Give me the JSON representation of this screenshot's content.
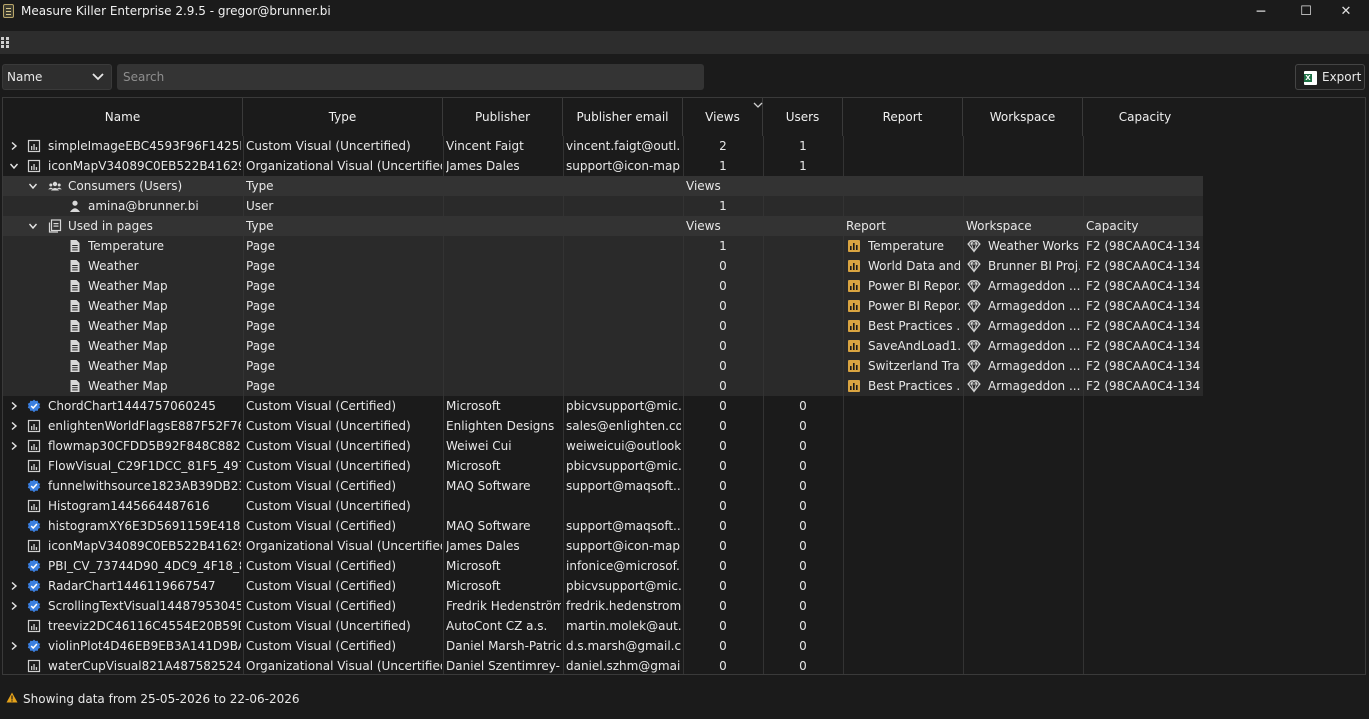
{
  "window": {
    "title": "Measure Killer Enterprise 2.9.5 - gregor@brunner.bi",
    "minimize": "─",
    "maximize": "☐",
    "close": "✕"
  },
  "toolbar": {
    "filter_selected": "Name",
    "search_placeholder": "Search",
    "export_label": "Export"
  },
  "columns": [
    "Name",
    "Type",
    "Publisher",
    "Publisher email",
    "Views",
    "Users",
    "Report",
    "Workspace",
    "Capacity"
  ],
  "visuals": [
    {
      "name": "simpleImageEBC4593F96F1425FB3...",
      "type": "Custom Visual (Uncertified)",
      "publisher": "Vincent Faigt",
      "email": "vincent.faigt@outl...",
      "views": "2",
      "users": "1",
      "expander": "collapsed",
      "icon": "chart-icon"
    },
    {
      "name": "iconMapV34089C0EB522B416294A...",
      "type": "Organizational Visual (Uncertified)",
      "publisher": "James Dales",
      "email": "support@icon-map...",
      "views": "1",
      "users": "1",
      "expander": "expanded",
      "icon": "chart-icon"
    },
    {
      "name": "ChordChart1444757060245",
      "type": "Custom Visual (Certified)",
      "publisher": "Microsoft",
      "email": "pbicvsupport@mic...",
      "views": "0",
      "users": "0",
      "expander": "collapsed",
      "icon": "certified-badge-icon"
    },
    {
      "name": "enlightenWorldFlagsE887F52F7624...",
      "type": "Custom Visual (Uncertified)",
      "publisher": "Enlighten Designs",
      "email": "sales@enlighten.co...",
      "views": "0",
      "users": "0",
      "expander": "collapsed",
      "icon": "chart-icon"
    },
    {
      "name": "flowmap30CFDD5B92F848C88242...",
      "type": "Custom Visual (Uncertified)",
      "publisher": "Weiwei Cui",
      "email": "weiweicui@outlook...",
      "views": "0",
      "users": "0",
      "expander": "collapsed",
      "icon": "chart-icon"
    },
    {
      "name": "FlowVisual_C29F1DCC_81F5_4973_...",
      "type": "Custom Visual (Uncertified)",
      "publisher": "Microsoft",
      "email": "pbicvsupport@mic...",
      "views": "0",
      "users": "0",
      "expander": "none",
      "icon": "chart-icon"
    },
    {
      "name": "funnelwithsource1823AB39DB234...",
      "type": "Custom Visual (Certified)",
      "publisher": "MAQ Software",
      "email": "support@maqsoft...",
      "views": "0",
      "users": "0",
      "expander": "none",
      "icon": "certified-badge-icon"
    },
    {
      "name": "Histogram1445664487616",
      "type": "Custom Visual (Uncertified)",
      "publisher": "",
      "email": "",
      "views": "0",
      "users": "0",
      "expander": "none",
      "icon": "chart-icon"
    },
    {
      "name": "histogramXY6E3D5691159E41859A...",
      "type": "Custom Visual (Certified)",
      "publisher": "MAQ Software",
      "email": "support@maqsoft...",
      "views": "0",
      "users": "0",
      "expander": "none",
      "icon": "certified-badge-icon"
    },
    {
      "name": "iconMapV34089C0EB522B416294A...",
      "type": "Organizational Visual (Uncertified)",
      "publisher": "James Dales",
      "email": "support@icon-map...",
      "views": "0",
      "users": "0",
      "expander": "none",
      "icon": "chart-icon"
    },
    {
      "name": "PBI_CV_73744D90_4DC9_4F18_8BA...",
      "type": "Custom Visual (Certified)",
      "publisher": "Microsoft",
      "email": "infonice@microsof...",
      "views": "0",
      "users": "0",
      "expander": "none",
      "icon": "certified-badge-icon"
    },
    {
      "name": "RadarChart1446119667547",
      "type": "Custom Visual (Certified)",
      "publisher": "Microsoft",
      "email": "pbicvsupport@mic...",
      "views": "0",
      "users": "0",
      "expander": "collapsed",
      "icon": "certified-badge-icon"
    },
    {
      "name": "ScrollingTextVisual1448795304508",
      "type": "Custom Visual (Certified)",
      "publisher": "Fredrik Hedenström",
      "email": "fredrik.hedenstrom...",
      "views": "0",
      "users": "0",
      "expander": "collapsed",
      "icon": "certified-badge-icon"
    },
    {
      "name": "treeviz2DC46116C4554E20B59DD5...",
      "type": "Custom Visual (Uncertified)",
      "publisher": "AutoCont CZ a.s.",
      "email": "martin.molek@aut...",
      "views": "0",
      "users": "0",
      "expander": "none",
      "icon": "chart-icon"
    },
    {
      "name": "violinPlot4D46EB9EB3A141D9BA22...",
      "type": "Custom Visual (Certified)",
      "publisher": "Daniel Marsh-Patrick",
      "email": "d.s.marsh@gmail.c...",
      "views": "0",
      "users": "0",
      "expander": "collapsed",
      "icon": "certified-badge-icon"
    },
    {
      "name": "waterCupVisual821A487582524ED6...",
      "type": "Organizational Visual (Uncertified)",
      "publisher": "Daniel Szentimrey-...",
      "email": "daniel.szhm@gmail...",
      "views": "0",
      "users": "0",
      "expander": "none",
      "icon": "chart-icon"
    }
  ],
  "consumers": {
    "label": "Consumers (Users)",
    "type_header": "Type",
    "views_header": "Views",
    "items": [
      {
        "name": "amina@brunner.bi",
        "type": "User",
        "views": "1"
      }
    ]
  },
  "pages": {
    "label": "Used in pages",
    "type_header": "Type",
    "views_header": "Views",
    "report_header": "Report",
    "workspace_header": "Workspace",
    "capacity_header": "Capacity",
    "items": [
      {
        "name": "Temperature",
        "type": "Page",
        "views": "1",
        "report": "Temperature",
        "workspace": "Weather Works...",
        "capacity": "F2 (98CAA0C4-134F..."
      },
      {
        "name": "Weather",
        "type": "Page",
        "views": "0",
        "report": "World Data and...",
        "workspace": "Brunner BI Proj...",
        "capacity": "F2 (98CAA0C4-134F..."
      },
      {
        "name": "Weather Map",
        "type": "Page",
        "views": "0",
        "report": "Power BI Repor...",
        "workspace": "Armageddon ...",
        "capacity": "F2 (98CAA0C4-134F..."
      },
      {
        "name": "Weather Map",
        "type": "Page",
        "views": "0",
        "report": "Power BI Repor...",
        "workspace": "Armageddon ...",
        "capacity": "F2 (98CAA0C4-134F..."
      },
      {
        "name": "Weather Map",
        "type": "Page",
        "views": "0",
        "report": "Best Practices ...",
        "workspace": "Armageddon ...",
        "capacity": "F2 (98CAA0C4-134F..."
      },
      {
        "name": "Weather Map",
        "type": "Page",
        "views": "0",
        "report": "SaveAndLoad1...",
        "workspace": "Armageddon ...",
        "capacity": "F2 (98CAA0C4-134F..."
      },
      {
        "name": "Weather Map",
        "type": "Page",
        "views": "0",
        "report": "Switzerland Tra...",
        "workspace": "Armageddon ...",
        "capacity": "F2 (98CAA0C4-134F..."
      },
      {
        "name": "Weather Map",
        "type": "Page",
        "views": "0",
        "report": "Best Practices ...",
        "workspace": "Armageddon ...",
        "capacity": "F2 (98CAA0C4-134F..."
      }
    ]
  },
  "status": {
    "text": "Showing data from 25-05-2026 to 22-06-2026"
  },
  "colors": {
    "accent_blue": "#3a7fe0",
    "report_icon": "#d9a441",
    "warning": "#e5a21a",
    "background": "#1b1b1b"
  }
}
